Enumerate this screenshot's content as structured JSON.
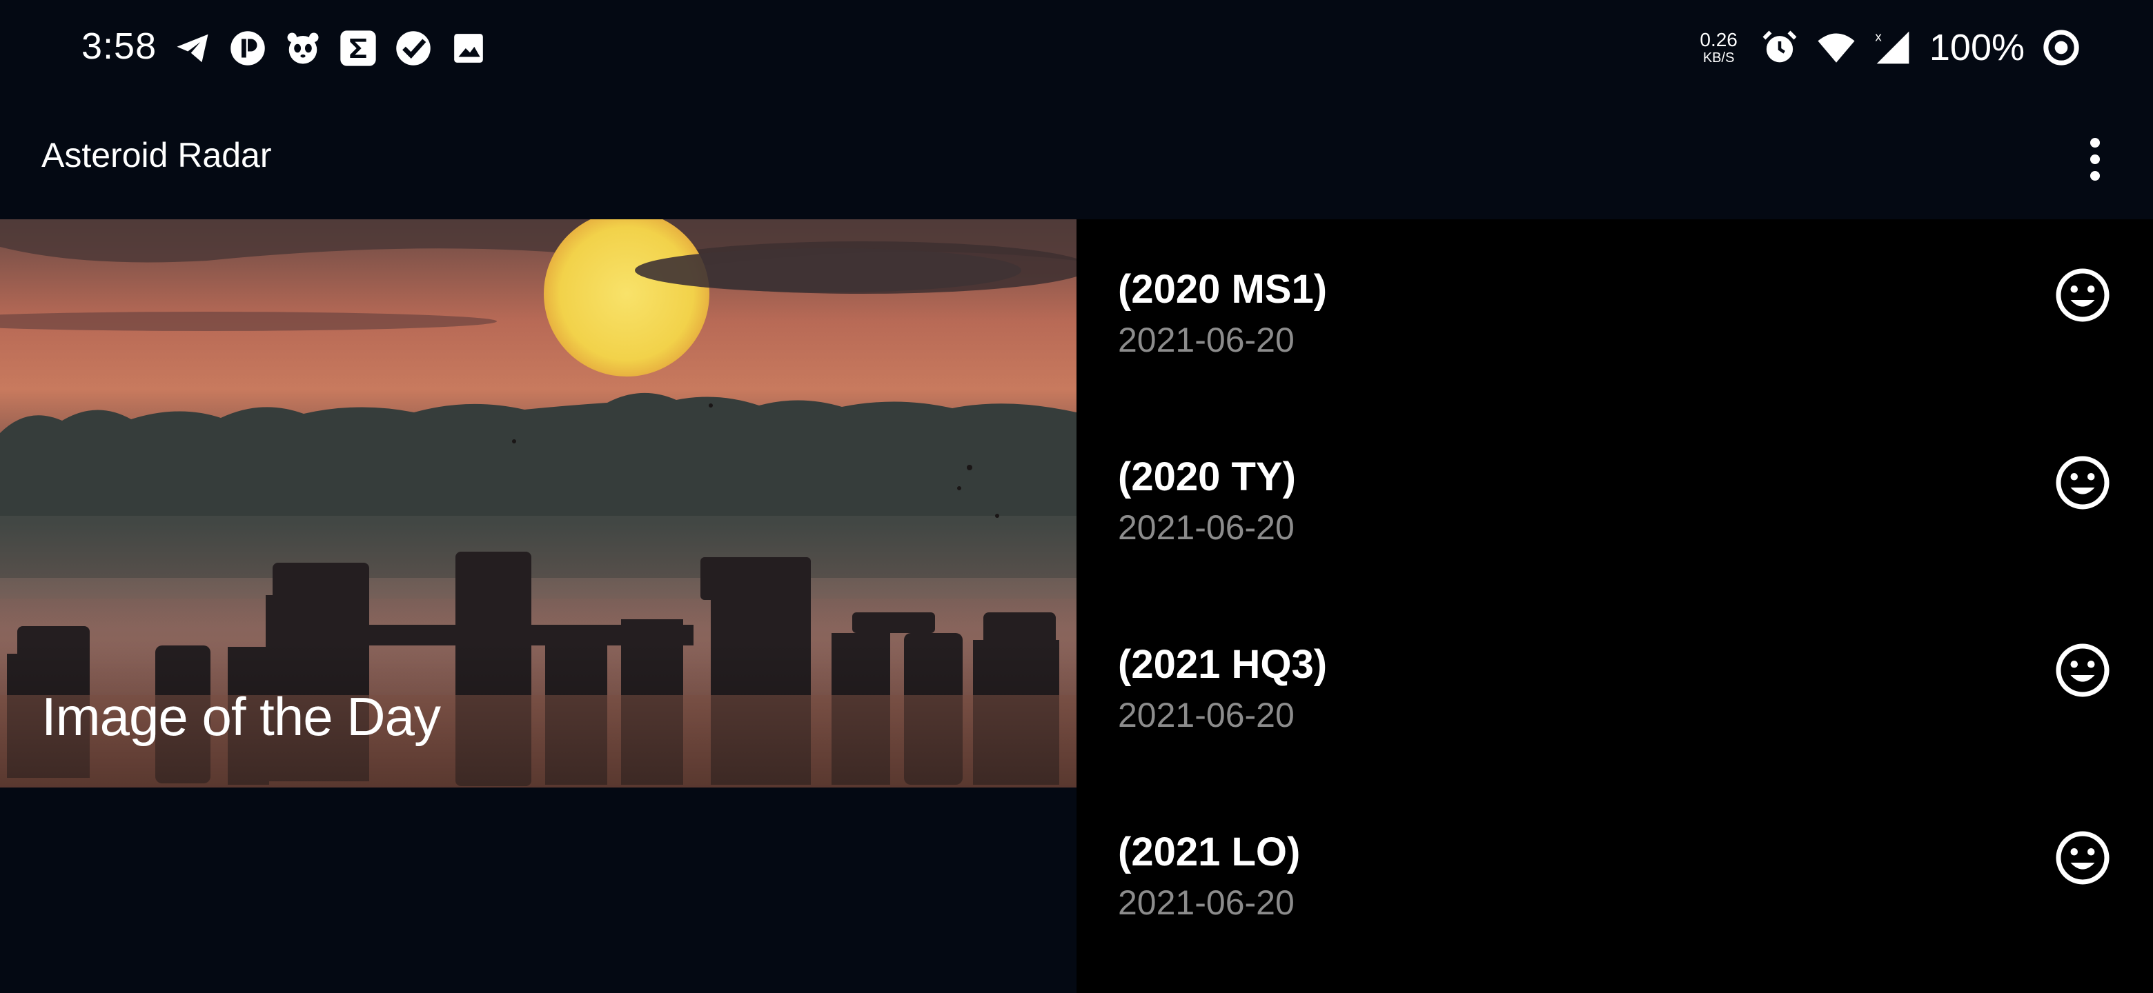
{
  "status_bar": {
    "time": "3:58",
    "left_icons": [
      "telegram-icon",
      "app-icon",
      "panda-icon",
      "sigma-icon",
      "check-badge-icon",
      "image-icon"
    ],
    "net_speed_value": "0.26",
    "net_speed_unit": "KB/S",
    "battery_text": "100%",
    "right_icons": [
      "alarm-icon",
      "wifi-icon",
      "signal-icon",
      "battery-ring-icon"
    ]
  },
  "app_bar": {
    "title": "Asteroid Radar",
    "menu_icon": "more-vert-icon"
  },
  "image_of_day": {
    "label": "Image of the Day"
  },
  "asteroids": [
    {
      "code": "(2020 MS1)",
      "date": "2021-06-20",
      "status_icon": "happy-face-icon"
    },
    {
      "code": "(2020 TY)",
      "date": "2021-06-20",
      "status_icon": "happy-face-icon"
    },
    {
      "code": "(2021 HQ3)",
      "date": "2021-06-20",
      "status_icon": "happy-face-icon"
    },
    {
      "code": "(2021 LO)",
      "date": "2021-06-20",
      "status_icon": "happy-face-icon"
    }
  ],
  "colors": {
    "background": "#040913",
    "list_background": "#000000",
    "text_primary": "#ffffff",
    "text_secondary": "#8c8c8c"
  }
}
